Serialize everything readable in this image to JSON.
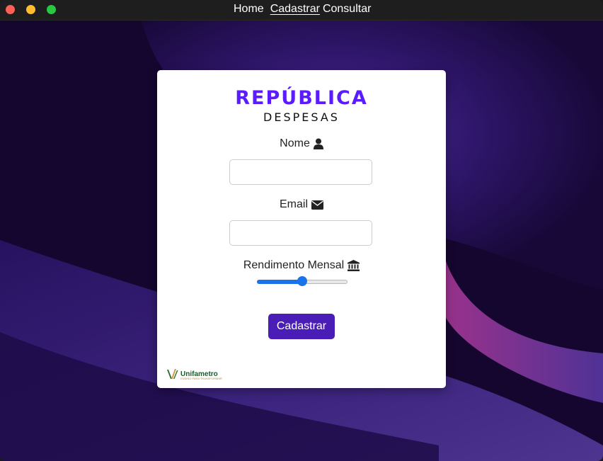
{
  "nav": {
    "items": [
      "Home",
      "Cadastrar",
      "Consultar"
    ],
    "active": "Cadastrar"
  },
  "brand": {
    "title": "REPÚBLICA",
    "subtitle": "DESPESAS"
  },
  "form": {
    "name_label": "Nome",
    "name_value": "",
    "email_label": "Email",
    "email_value": "",
    "income_label": "Rendimento Mensal",
    "income_slider_fraction": 0.5,
    "submit_label": "Cadastrar"
  },
  "footer": {
    "logo_text": "Unifametro",
    "logo_tagline": "ENSINO PARA TRANSFORMAR"
  },
  "icons": {
    "name": "user-icon",
    "email": "envelope-icon",
    "income": "bank-icon"
  },
  "colors": {
    "brand": "#5b1bff",
    "button": "#4a1db6",
    "slider": "#1a73e8"
  }
}
